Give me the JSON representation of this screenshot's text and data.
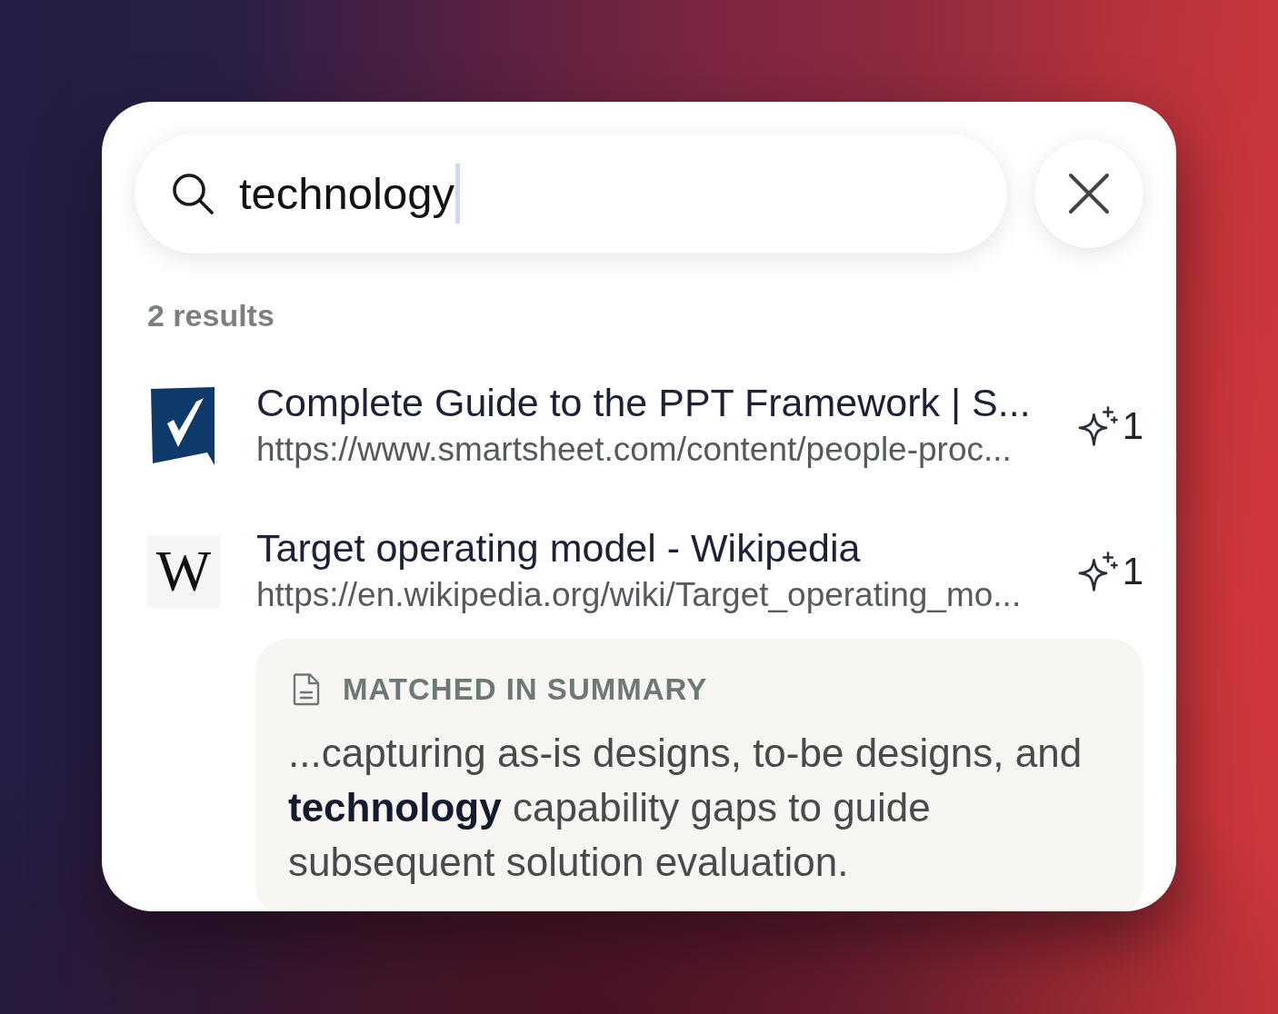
{
  "search": {
    "value": "technology",
    "focused": true
  },
  "results_count": "2 results",
  "results": [
    {
      "favicon": {
        "kind": "check-tile"
      },
      "title": "Complete Guide to the PPT Framework | S...",
      "url": "https://www.smartsheet.com/content/people-proc...",
      "matches": "1"
    },
    {
      "favicon": {
        "kind": "letter",
        "text": "W"
      },
      "title": "Target operating model - Wikipedia",
      "url": "https://en.wikipedia.org/wiki/Target_operating_mo...",
      "matches": "1",
      "match": {
        "label": "MATCHED IN SUMMARY",
        "snippet": "...capturing as-is designs, to-be designs, and **technology** capability gaps to guide subsequent solution evaluation."
      }
    }
  ]
}
